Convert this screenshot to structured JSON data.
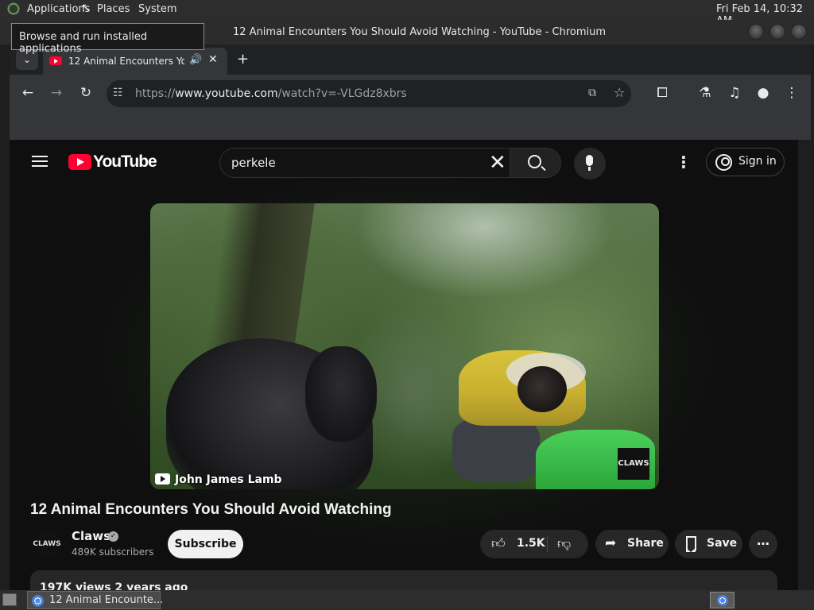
{
  "top_panel": {
    "applications": "Applications",
    "places": "Places",
    "system": "System",
    "datetime": "Fri Feb 14, 10:32 AM"
  },
  "tooltip": "Browse and run installed applications",
  "window": {
    "title": "12 Animal Encounters You Should Avoid Watching - YouTube - Chromium"
  },
  "browser": {
    "tab_title": "12 Animal Encounters You Should Avoid Watching - YouTube",
    "new_tab": "+",
    "url_scheme": "https://",
    "url_host": "www.youtube.com",
    "url_path": "/watch?v=-VLGdz8xbrs"
  },
  "youtube": {
    "logo_text": "YouTube",
    "search_value": "perkele",
    "sign_in": "Sign in",
    "video_credit": "John James Lamb",
    "video_watermark": "CLAWS",
    "video_title": "12 Animal Encounters You Should Avoid Watching",
    "channel_avatar": "CLAWS",
    "channel_name": "Claws",
    "subscribers": "489K subscribers",
    "subscribe": "Subscribe",
    "like_count": "1.5K",
    "share": "Share",
    "save": "Save",
    "view_stats": "197K views  2 years ago"
  },
  "taskbar": {
    "task_label": "12 Animal Encounte..."
  },
  "icons": [
    "apps-icon",
    "chevron-down-icon",
    "youtube-favicon",
    "audio-icon",
    "close-icon",
    "back-icon",
    "forward-icon",
    "reload-icon",
    "site-info-icon",
    "install-icon",
    "star-icon",
    "extensions-icon",
    "labs-icon",
    "media-icon",
    "profile-icon",
    "menu-icon",
    "hamburger-icon",
    "search-icon",
    "mic-icon",
    "account-icon",
    "verified-icon",
    "like-icon",
    "dislike-icon",
    "share-icon",
    "save-icon"
  ],
  "colors": {
    "youtube_red": "#ff0033",
    "page_bg": "#0f0f0f",
    "chrome_toolbar": "#35363a"
  }
}
